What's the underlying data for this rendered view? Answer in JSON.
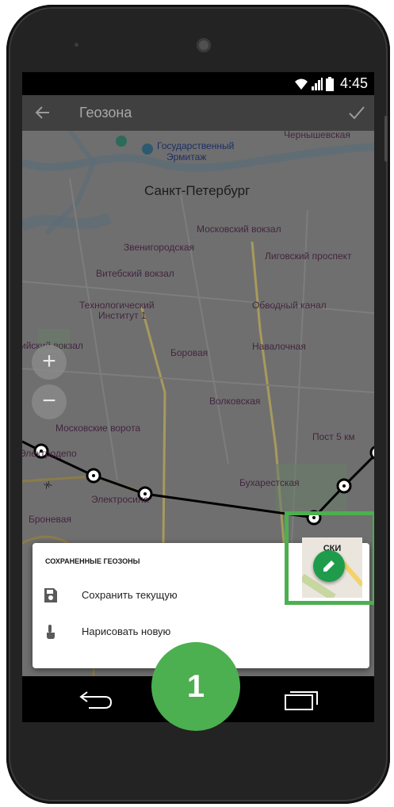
{
  "status_bar": {
    "time": "4:45"
  },
  "app_bar": {
    "title": "Геозона"
  },
  "map": {
    "city_label": "Санкт-Петербург",
    "labels": [
      "Государственный",
      "Эрмитаж",
      "Чернышевская",
      "Московский вокзал",
      "Звенигородская",
      "Лиговский проспект",
      "Витебский вокзал",
      "Технологический",
      "Институт 1",
      "Обводный канал",
      "ийский вокзал",
      "Боровая",
      "Навалочная",
      "Волковская",
      "Московские ворота",
      "Пост 5 км",
      "Электродепо",
      "Бухарестская",
      "Электросила",
      "Броневая",
      "Ж"
    ],
    "zoom_in_label": "+",
    "zoom_out_label": "−"
  },
  "sheet": {
    "title": "СОХРАНЕННЫЕ ГЕОЗОНЫ",
    "items": [
      {
        "label": "Сохранить текущую",
        "icon": "save-icon"
      },
      {
        "label": "Нарисовать новую",
        "icon": "touch-draw-icon"
      }
    ]
  },
  "thumbnail": {
    "label": "СКИ"
  },
  "callout": {
    "number": "1"
  },
  "colors": {
    "accent_green": "#4caf50",
    "fab_green": "#1e9c4b",
    "map_dim": "#6f6f6f",
    "appbar": "#404040"
  }
}
